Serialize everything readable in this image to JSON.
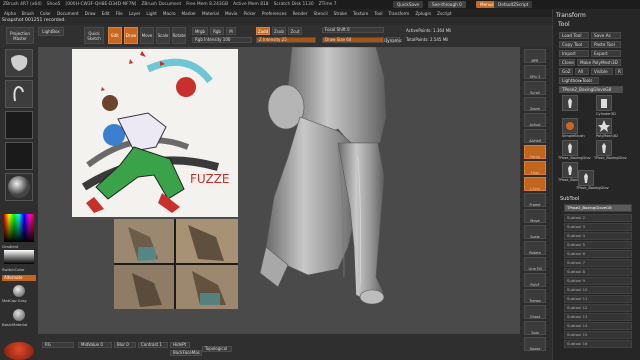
{
  "titlebar": {
    "items": [
      "ZBrush 4R7 (x64)",
      "Shoe5",
      "[000H-CW3F-QH8E-D34D-NF7N]",
      "ZBrush Document",
      "Free Mem 8.243GB",
      "Active Mem 818",
      "Scratch Disk 1130",
      "ZTime 7"
    ],
    "quicksave": "QuickSave",
    "seethrough": "See-through 0",
    "menus": "Menus",
    "script": "DefaultZScript"
  },
  "menu": {
    "items": [
      "Alpha",
      "Brush",
      "Color",
      "Document",
      "Draw",
      "Edit",
      "File",
      "Layer",
      "Light",
      "Macro",
      "Marker",
      "Material",
      "Movie",
      "Picker",
      "Preferences",
      "Render",
      "Stencil",
      "Stroke",
      "Texture",
      "Tool",
      "Transform",
      "Zplugin",
      "Zscript"
    ]
  },
  "note": "Snapshot 001251 recorded.",
  "shelf": {
    "projection": "Projection Master",
    "lightbox": "LightBox",
    "quicksketch": "Quick Sketch",
    "edit": "Edit",
    "draw": "Draw",
    "move": "Move",
    "scale": "Scale",
    "rotate": "Rotate",
    "mrgb": "Mrgb",
    "rgb": "Rgb",
    "m": "M",
    "zadd": "Zadd",
    "zsub": "Zsub",
    "zcut": "Zcut",
    "focal": "Focal Shift 0",
    "drawsize": "Draw Size 64",
    "dynamic": "Dynamic",
    "active_points": "ActivePoints: 1.364 Mil",
    "total_points": "TotalPoints: 2.545 Mil",
    "rgb_int": "Rgb Intensity 100",
    "z_int": "Z Intensity 25"
  },
  "leftshelf": {
    "gradient": "Gradient",
    "switchcolor": "SwitchColor",
    "alternate": "Alternate",
    "matcap": "MatCap Gray",
    "basicmaterial": "BasicMaterial"
  },
  "rightshelf": [
    "BPR",
    "SPix 3",
    "Scroll",
    "Zoom",
    "Actual",
    "AAHalf",
    "Persp",
    "Floor",
    "L.Sym",
    "Frame",
    "Move",
    "Scale",
    "Rotate",
    "Line Fill",
    "PolyF",
    "Transp",
    "Ghost",
    "Solo",
    "Xpose"
  ],
  "tray": {
    "title": "Transform",
    "tool_title": "Tool",
    "load_tool": "Load Tool",
    "save_as": "Save As",
    "copy_tool": "Copy Tool",
    "paste_tool": "Paste Tool",
    "import": "Import",
    "export": "Export",
    "clone": "Clone",
    "make_polymesh": "Make PolyMesh3D",
    "goz": "GoZ",
    "all": "All",
    "visible": "Visible",
    "r": "R",
    "lightbox_tools": "Lightbox▸Tools",
    "current_tool": "TPose2_BoxingGloveG8",
    "tools": [
      "TPose2_BoxingGlov",
      "Cylinder3D",
      "PolyMesh3D",
      "SimpleBrush",
      "TPose_BoxingGlov",
      "TPose_BoxingGlov",
      "TPose_BoxingGlov",
      "TPose_BoxingGlov"
    ],
    "subtool": "SubTool",
    "subtool_first": "TPose2_BoxingGloveG8",
    "subtool_rows": [
      "Subtool 2",
      "Subtool 3",
      "Subtool 4",
      "Subtool 5",
      "Subtool 6",
      "Subtool 7",
      "Subtool 8",
      "Subtool 9",
      "Subtool 10",
      "Subtool 11",
      "Subtool 12",
      "Subtool 13",
      "Subtool 14",
      "Subtool 15",
      "Subtool 16"
    ]
  },
  "bottom": {
    "rgb_val": "RG",
    "midvalue": "MidValue 0",
    "blur": "Blur 0",
    "contrast": "Contrast 1",
    "hidept": "HidePt",
    "backface": "BackFaceMas",
    "topological": "Topological"
  },
  "concept": {
    "signature": "FUZZE"
  }
}
